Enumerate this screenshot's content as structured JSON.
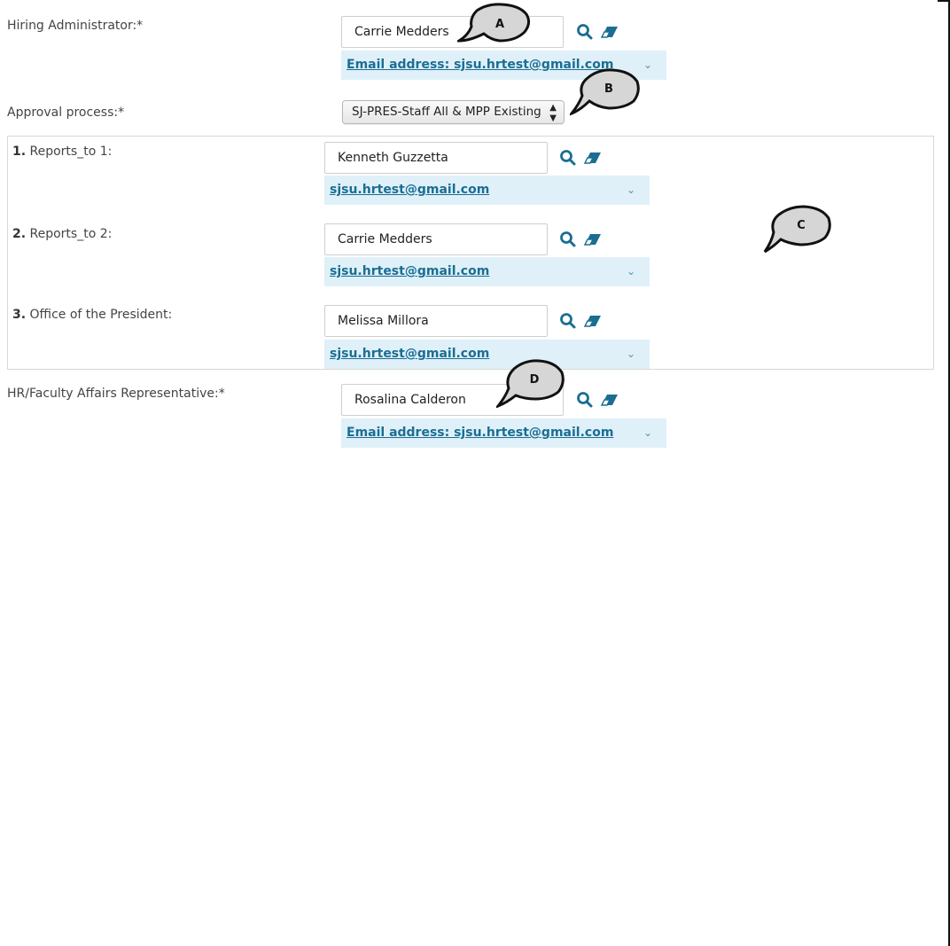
{
  "hiring_admin": {
    "label": "Hiring Administrator:*",
    "value": "Carrie Medders",
    "email": "Email address: sjsu.hrtest@gmail.com"
  },
  "approval": {
    "label": "Approval process:*",
    "selected": "SJ-PRES-Staff All & MPP Existing"
  },
  "approvers": [
    {
      "num": "1.",
      "label": "Reports_to 1:",
      "value": "Kenneth Guzzetta",
      "email": "sjsu.hrtest@gmail.com"
    },
    {
      "num": "2.",
      "label": "Reports_to 2:",
      "value": "Carrie Medders",
      "email": "sjsu.hrtest@gmail.com"
    },
    {
      "num": "3.",
      "label": "Office of the President:",
      "value": "Melissa Millora",
      "email": "sjsu.hrtest@gmail.com"
    }
  ],
  "hr_rep": {
    "label": "HR/Faculty Affairs Representative:*",
    "value": "Rosalina Calderon",
    "email": "Email address: sjsu.hrtest@gmail.com"
  },
  "callouts": {
    "a": "A",
    "b": "B",
    "c": "C",
    "d": "D"
  },
  "icons": {
    "search": "search-icon",
    "clear": "eraser-icon",
    "chevron": "chevron-down-icon"
  },
  "colors": {
    "accent": "#1b6e92",
    "email_bg": "#dff0f9"
  }
}
